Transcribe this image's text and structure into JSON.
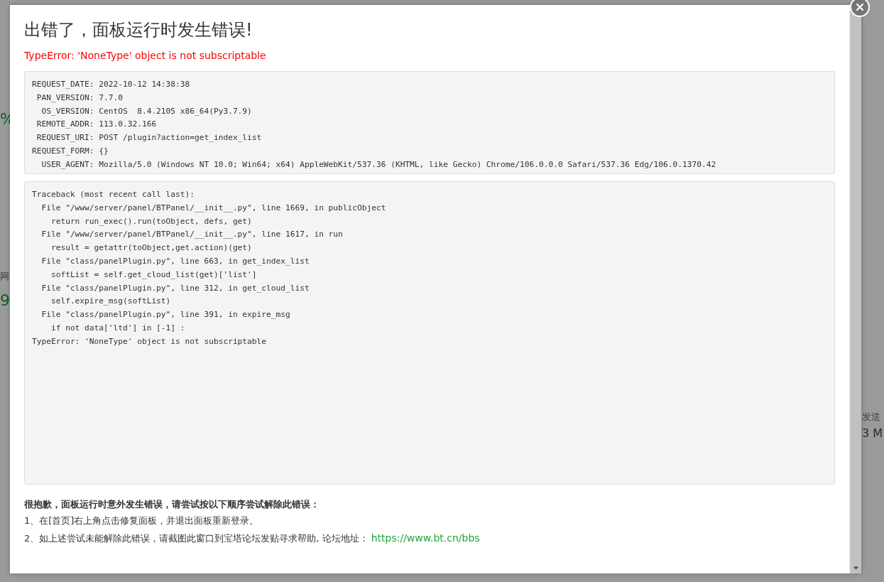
{
  "background": {
    "left_texts": [
      {
        "text": "%",
        "kind": "number"
      },
      {
        "text": "网",
        "kind": "label"
      },
      {
        "text": "9",
        "kind": "number"
      }
    ],
    "right_texts": [
      {
        "text": "发送",
        "kind": "label"
      },
      {
        "text": "3 M",
        "kind": "value"
      }
    ]
  },
  "dialog": {
    "title": "出错了，面板运行时发生错误!",
    "error": "TypeError: 'NoneType' object is not subscriptable",
    "request_info": [
      "REQUEST_DATE: 2022-10-12 14:38:38",
      " PAN_VERSION: 7.7.0",
      "  OS_VERSION: CentOS  8.4.2105 x86_64(Py3.7.9)",
      " REMOTE_ADDR: 113.0.32.166",
      " REQUEST_URI: POST /plugin?action=get_index_list",
      "REQUEST_FORM: {}",
      "  USER_AGENT: Mozilla/5.0 (Windows NT 10.0; Win64; x64) AppleWebKit/537.36 (KHTML, like Gecko) Chrome/106.0.0.0 Safari/537.36 Edg/106.0.1370.42"
    ],
    "traceback": [
      "Traceback (most recent call last):",
      "  File \"/www/server/panel/BTPanel/__init__.py\", line 1669, in publicObject",
      "    return run_exec().run(toObject, defs, get)",
      "  File \"/www/server/panel/BTPanel/__init__.py\", line 1617, in run",
      "    result = getattr(toObject,get.action)(get)",
      "  File \"class/panelPlugin.py\", line 663, in get_index_list",
      "    softList = self.get_cloud_list(get)['list']",
      "  File \"class/panelPlugin.py\", line 312, in get_cloud_list",
      "    self.expire_msg(softList)",
      "  File \"class/panelPlugin.py\", line 391, in expire_msg",
      "    if not data['ltd'] in [-1] :",
      "TypeError: 'NoneType' object is not subscriptable"
    ],
    "help_heading": "很抱歉，面板运行时意外发生错误，请尝试按以下顺序尝试解除此错误：",
    "help_steps": [
      {
        "text": "1、在[首页]右上角点击修复面板，并退出面板重新登录。"
      },
      {
        "text": "2、如上述尝试未能解除此错误，请截图此窗口到宝塔论坛发贴寻求帮助, 论坛地址：",
        "link": "https://www.bt.cn/bbs"
      }
    ]
  }
}
